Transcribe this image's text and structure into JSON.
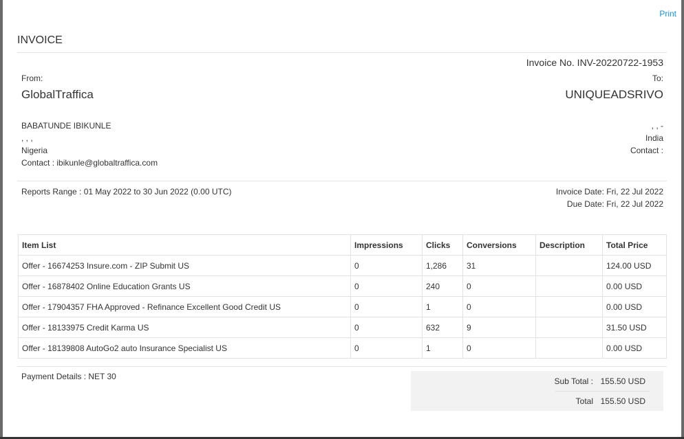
{
  "print_label": "Print",
  "title": "INVOICE",
  "invoice_no": "Invoice No. INV-20220722-1953",
  "from": {
    "label": "From:",
    "company": "GlobalTraffica",
    "name": "BABATUNDE IBIKUNLE",
    "address": ", , ,",
    "country": "Nigeria",
    "contact": "Contact : ibikunle@globaltraffica.com"
  },
  "to": {
    "label": "To:",
    "company": "UNIQUEADSRIVO",
    "address": ", , -",
    "country": "India",
    "contact": "Contact :"
  },
  "reports_range": "Reports Range : 01 May 2022 to 30 Jun 2022 (0.00 UTC)",
  "invoice_date": "Invoice Date: Fri, 22 Jul 2022",
  "due_date": "Due Date: Fri, 22 Jul 2022",
  "table": {
    "headers": [
      "Item List",
      "Impressions",
      "Clicks",
      "Conversions",
      "Description",
      "Total Price"
    ],
    "rows": [
      [
        "Offer - 16674253 Insure.com - ZIP Submit US",
        "0",
        "1,286",
        "31",
        "",
        "124.00 USD"
      ],
      [
        "Offer - 16878402 Online Education Grants US",
        "0",
        "240",
        "0",
        "",
        "0.00 USD"
      ],
      [
        "Offer - 17904357 FHA Approved - Refinance Excellent Good Credit US",
        "0",
        "1",
        "0",
        "",
        "0.00 USD"
      ],
      [
        "Offer - 18133975 Credit Karma US",
        "0",
        "632",
        "9",
        "",
        "31.50 USD"
      ],
      [
        "Offer - 18139808 AutoGo2 auto Insurance Specialist US",
        "0",
        "1",
        "0",
        "",
        "0.00 USD"
      ]
    ]
  },
  "payment_details": "Payment Details : NET 30",
  "totals": {
    "subtotal_label": "Sub Total :",
    "subtotal_value": "155.50 USD",
    "total_label": "Total",
    "total_value": "155.50 USD"
  },
  "colors": {
    "link": "#1a8fd6",
    "totals_bg": "#f2f2f2"
  }
}
